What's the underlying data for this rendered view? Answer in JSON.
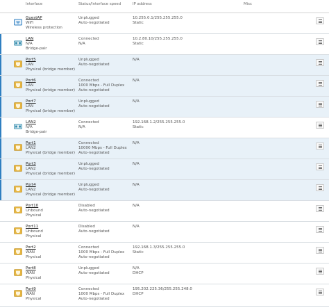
{
  "header": {
    "interface": "Interface",
    "status": "Status/Interface speed",
    "ip": "IP address",
    "misc": "Misc"
  },
  "rows": [
    {
      "name": "GuestAP",
      "type": "WiFi",
      "role": "Wireless protection",
      "status": "Unplugged",
      "speed": "Auto-negotiated",
      "speed2": "",
      "ip": "10.255.0.1/255.255.255.0",
      "ip2": "Static",
      "icon": "wifi-icon"
    },
    {
      "name": "LAN",
      "type": "N/A",
      "role": "Bridge-pair",
      "status": "Connected",
      "speed": "N/A",
      "speed2": "",
      "ip": "10.2.80.10/255.255.255.0",
      "ip2": "Static",
      "icon": "bridge-icon"
    },
    {
      "name": "Port5",
      "type": "LAN",
      "role": "Physical (bridge member)",
      "status": "Unplugged",
      "speed": "Auto-negotiated",
      "speed2": "",
      "ip": "N/A",
      "ip2": "",
      "icon": "port-icon"
    },
    {
      "name": "Port6",
      "type": "LAN",
      "role": "Physical (bridge member)",
      "status": "Connected",
      "speed": "1000 Mbps - Full Duplex",
      "speed2": "Auto-negotiated",
      "ip": "N/A",
      "ip2": "",
      "icon": "port-icon"
    },
    {
      "name": "Port7",
      "type": "LAN",
      "role": "Physical (bridge member)",
      "status": "Unplugged",
      "speed": "Auto-negotiated",
      "speed2": "",
      "ip": "N/A",
      "ip2": "",
      "icon": "port-icon"
    },
    {
      "name": "LAN2",
      "type": "N/A",
      "role": "Bridge-pair",
      "status": "Connected",
      "speed": "N/A",
      "speed2": "",
      "ip": "192.168.1.2/255.255.255.0",
      "ip2": "Static",
      "icon": "bridge-icon"
    },
    {
      "name": "Port1",
      "type": "LAN2",
      "role": "Physical (bridge member)",
      "status": "Connected",
      "speed": "10000 Mbps - Full Duplex",
      "speed2": "Auto-negotiated",
      "ip": "N/A",
      "ip2": "",
      "icon": "port-icon"
    },
    {
      "name": "Port3",
      "type": "LAN2",
      "role": "Physical (bridge member)",
      "status": "Unplugged",
      "speed": "Auto-negotiated",
      "speed2": "",
      "ip": "N/A",
      "ip2": "",
      "icon": "port-icon"
    },
    {
      "name": "Port4",
      "type": "LAN2",
      "role": "Physical (bridge member)",
      "status": "Unplugged",
      "speed": "Auto-negotiated",
      "speed2": "",
      "ip": "N/A",
      "ip2": "",
      "icon": "port-icon"
    },
    {
      "name": "Port10",
      "type": "Unbound",
      "role": "Physical",
      "status": "Disabled",
      "speed": "Auto-negotiated",
      "speed2": "",
      "ip": "N/A",
      "ip2": "",
      "icon": "port-icon"
    },
    {
      "name": "Port11",
      "type": "Unbound",
      "role": "Physical",
      "status": "Disabled",
      "speed": "Auto-negotiated",
      "speed2": "",
      "ip": "N/A",
      "ip2": "",
      "icon": "port-icon"
    },
    {
      "name": "Port2",
      "type": "WAN",
      "role": "Physical",
      "status": "Connected",
      "speed": "1000 Mbps - Full Duplex",
      "speed2": "Auto-negotiated",
      "ip": "192.168.1.3/255.255.255.0",
      "ip2": "Static",
      "icon": "port-icon"
    },
    {
      "name": "Port8",
      "type": "WAN",
      "role": "Physical",
      "status": "Unplugged",
      "speed": "Auto-negotiated",
      "speed2": "",
      "ip": "N/A",
      "ip2": "DHCP",
      "icon": "port-icon"
    },
    {
      "name": "Port9",
      "type": "WAN",
      "role": "Physical",
      "status": "Connected",
      "speed": "1000 Mbps - Full Duplex",
      "speed2": "Auto-negotiated",
      "ip": "195.202.225.36/255.255.248.0",
      "ip2": "DHCP",
      "icon": "port-icon"
    }
  ],
  "colors": {
    "accent": "#2f7fc1",
    "port": "#e7b640",
    "alt_row": "#e8f1f8"
  }
}
